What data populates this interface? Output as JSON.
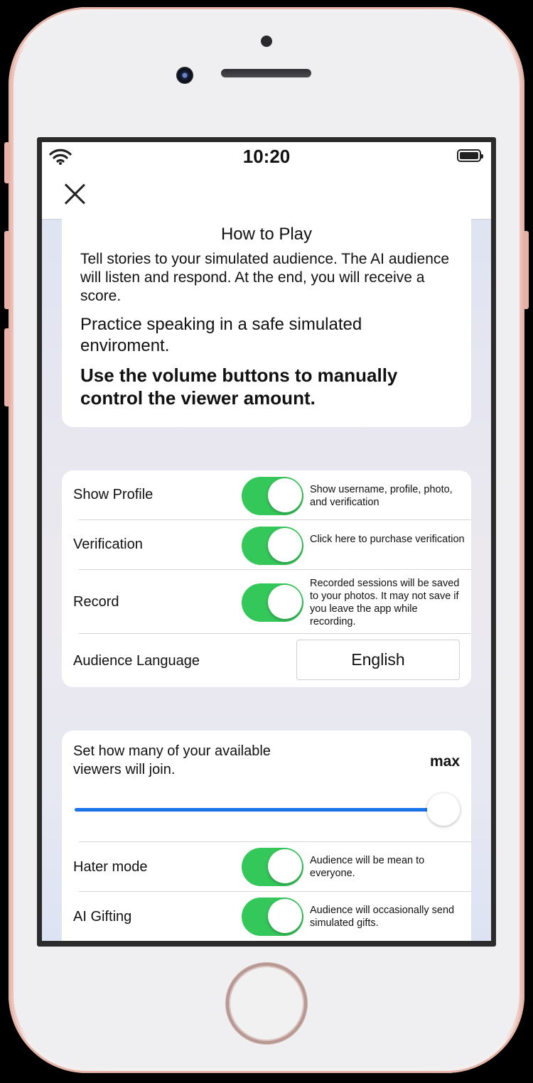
{
  "status_bar": {
    "time": "10:20"
  },
  "how_to_play": {
    "title": "How to Play",
    "paragraph1": "Tell stories to your simulated audience. The AI audience will listen and respond. At the end, you will receive a score.",
    "paragraph2": "Practice speaking in a safe simulated enviroment.",
    "paragraph3": "Use the volume buttons to manually control the viewer amount."
  },
  "settings": {
    "show_profile": {
      "label": "Show Profile",
      "description": "Show username, profile, photo, and verification",
      "on": true
    },
    "verification": {
      "label": "Verification",
      "description": "Click here to purchase verification",
      "on": true
    },
    "record": {
      "label": "Record",
      "description": "Recorded sessions will be saved to your photos. It may not save if you leave the app while recording.",
      "on": true
    },
    "audience_language": {
      "label": "Audience Language",
      "value": "English"
    }
  },
  "viewers": {
    "question": "Set how many of your available viewers will join.",
    "value_label": "max",
    "slider_value": 1.0,
    "hater_mode": {
      "label": "Hater mode",
      "description": "Audience will be mean to everyone.",
      "on": true
    },
    "ai_gifting": {
      "label": "AI Gifting",
      "description": "Audience will occasionally send simulated gifts.",
      "on": true
    }
  },
  "colors": {
    "toggle_on": "#34c759",
    "slider_fill": "#1a73e8"
  }
}
